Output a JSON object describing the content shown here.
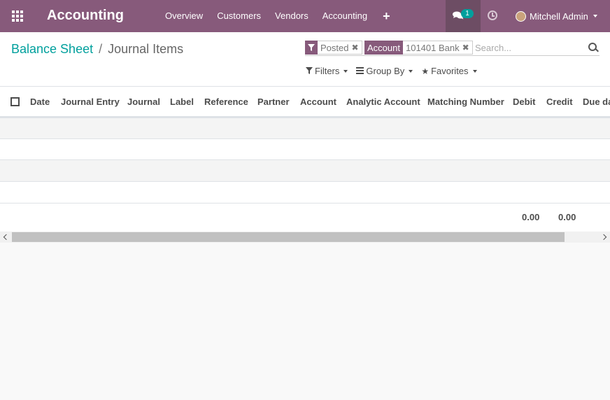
{
  "navbar": {
    "brand": "Accounting",
    "menu": [
      "Overview",
      "Customers",
      "Vendors",
      "Accounting"
    ],
    "plus_icon": "+",
    "chat_badge": "1",
    "user_name": "Mitchell Admin",
    "accent_color": "#875a7b"
  },
  "breadcrumb": {
    "parent": "Balance Sheet",
    "separator": "/",
    "current": "Journal Items"
  },
  "search": {
    "facets": [
      {
        "tag_icon": "filter-icon",
        "value": "Posted"
      },
      {
        "tag": "Account",
        "value": "101401 Bank"
      }
    ],
    "placeholder": "Search..."
  },
  "filters": {
    "filters_label": "Filters",
    "groupby_label": "Group By",
    "favorites_label": "Favorites"
  },
  "table": {
    "columns": [
      "Date",
      "Journal Entry",
      "Journal",
      "Label",
      "Reference",
      "Partner",
      "Account",
      "Analytic Account",
      "Matching Number",
      "Debit",
      "Credit",
      "Due da"
    ],
    "rows": [],
    "totals": {
      "debit": "0.00",
      "credit": "0.00"
    }
  }
}
